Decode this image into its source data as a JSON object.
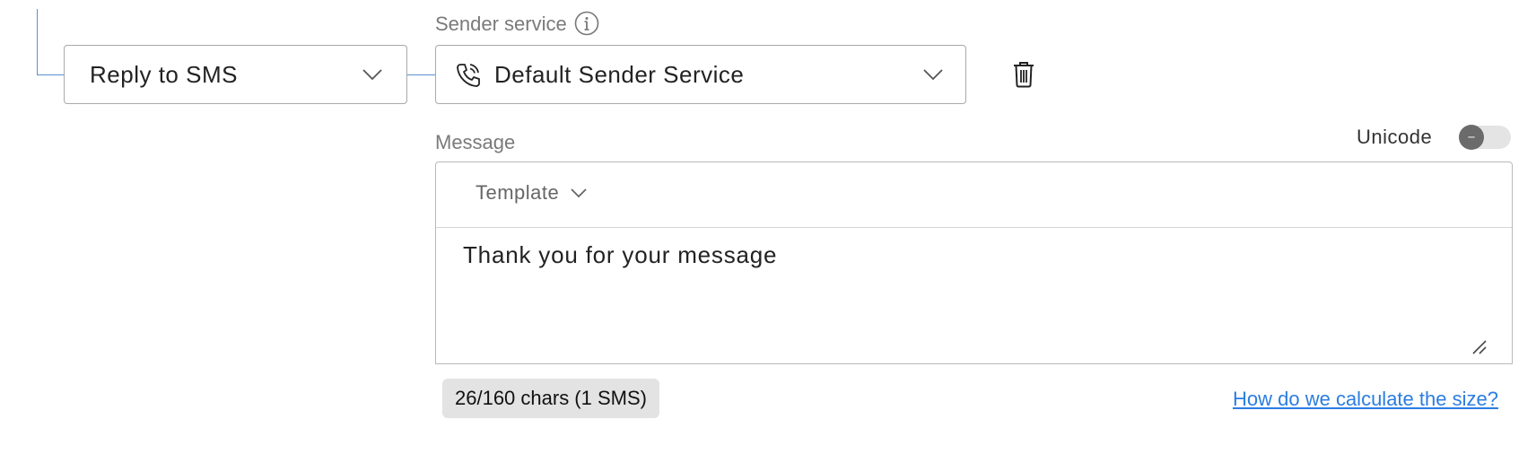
{
  "action_select": {
    "value": "Reply to SMS",
    "icon": "chevron-down-icon"
  },
  "sender_service": {
    "label": "Sender service",
    "info_icon": "info-icon",
    "value": "Default Sender Service",
    "service_icon": "phone-icon",
    "chevron_icon": "chevron-down-icon"
  },
  "delete": {
    "icon": "trash-icon"
  },
  "message": {
    "label": "Message",
    "template_label": "Template",
    "text": "Thank you for your message"
  },
  "unicode": {
    "label": "Unicode",
    "enabled": false
  },
  "footer": {
    "chars_info": "26/160 chars (1 SMS)",
    "help_link": "How do we calculate the size?"
  },
  "colors": {
    "connector": "#5b8fd6",
    "link": "#2a7de1",
    "border": "#a9a9a9",
    "badge_bg": "#e3e3e3"
  }
}
